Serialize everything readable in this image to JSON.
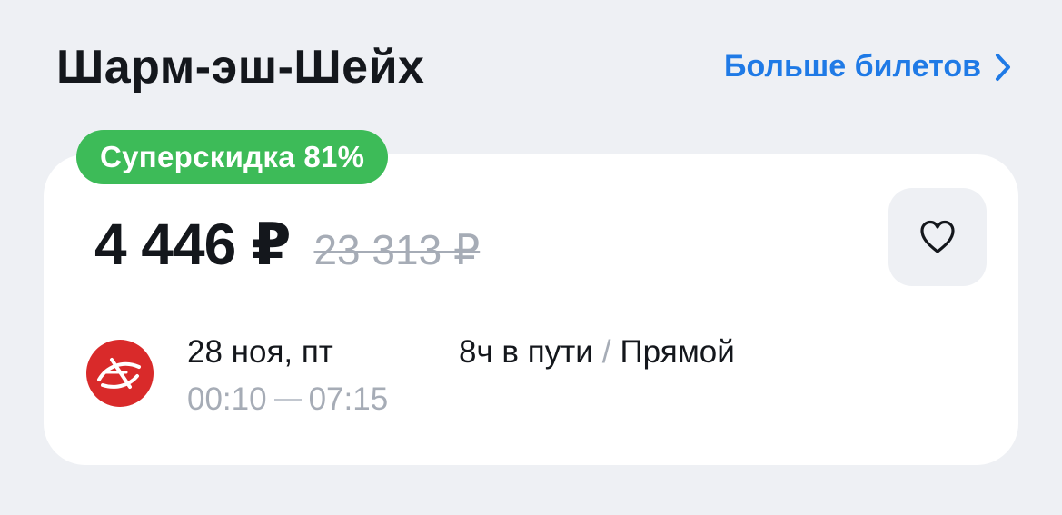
{
  "header": {
    "title": "Шарм-эш-Шейх",
    "more_link": "Больше билетов"
  },
  "offer": {
    "badge": "Суперскидка 81%",
    "price": "4 446 ₽",
    "old_price": "23 313 ₽"
  },
  "flight": {
    "date": "28 ноя, пт",
    "departure": "00:10",
    "arrival": "07:15",
    "duration": "8ч в пути",
    "separator": "/",
    "type": "Прямой"
  },
  "icons": {
    "favorite": "heart-icon",
    "more": "chevron-right-icon",
    "airline": "airline-logo"
  },
  "colors": {
    "accent": "#1f7ae6",
    "badge": "#3dbb58",
    "airline": "#d92a2a"
  }
}
